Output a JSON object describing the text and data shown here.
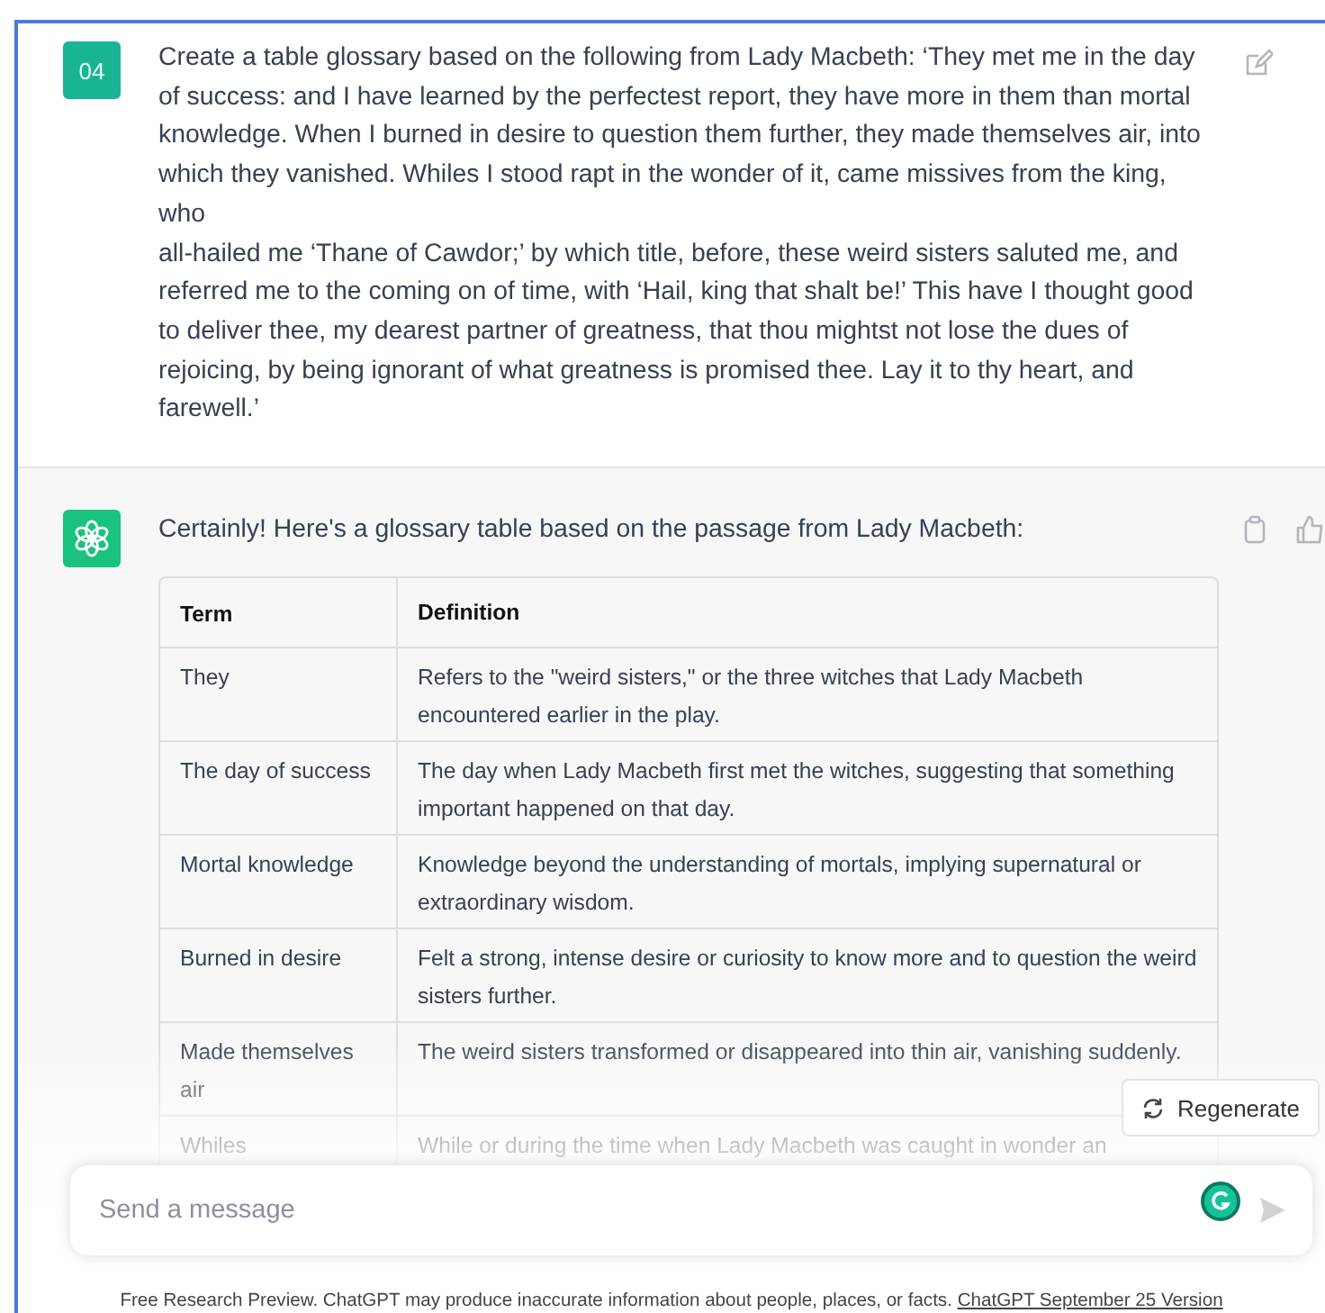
{
  "conversation": [
    {
      "kind": "prompt",
      "avatar": "04",
      "text": "Create a table glossary based on the following from Lady Macbeth: ‘They met me in the day of success: and I have learned by the perfectest report, they have more in them than mortal knowledge. When I burned in desire to question them further, they made themselves air, into which they vanished. Whiles I stood rapt in the wonder of it, came missives from the king, who\nall-hailed me ‘Thane of Cawdor;’ by which title, before, these weird sisters saluted me, and referred me to the coming on of time, with ‘Hail, king that shalt be!’ This have I thought good to deliver thee, my dearest partner of greatness, that thou mightst not lose the dues of rejoicing, by being ignorant of what greatness is promised thee. Lay it to thy heart, and farewell.’"
    },
    {
      "kind": "reply",
      "text": "Certainly! Here's a glossary table based on the passage from Lady Macbeth:",
      "table": {
        "columns": [
          "Term",
          "Definition"
        ],
        "rows": [
          [
            "They",
            "Refers to the \"weird sisters,\" or the three witches that Lady Macbeth encountered earlier in the play."
          ],
          [
            "The day of success",
            "The day when Lady Macbeth first met the witches, suggesting that something important happened on that day."
          ],
          [
            "Mortal knowledge",
            "Knowledge beyond the understanding of mortals, implying supernatural or extraordinary wisdom."
          ],
          [
            "Burned in desire",
            "Felt a strong, intense desire or curiosity to know more and to question the weird sisters further."
          ],
          [
            "Made themselves air",
            "The weird sisters transformed or disappeared into thin air, vanishing suddenly."
          ],
          [
            "Whiles",
            "While or during the time when Lady Macbeth was caught in wonder an"
          ]
        ]
      }
    }
  ],
  "regenerate_button": "Regenerate",
  "composer": {
    "placeholder": "Send a message"
  },
  "footer": {
    "text": "Free Research Preview. ChatGPT may produce inaccurate information about people, places, or facts.",
    "link": "ChatGPT September 25 Version"
  }
}
